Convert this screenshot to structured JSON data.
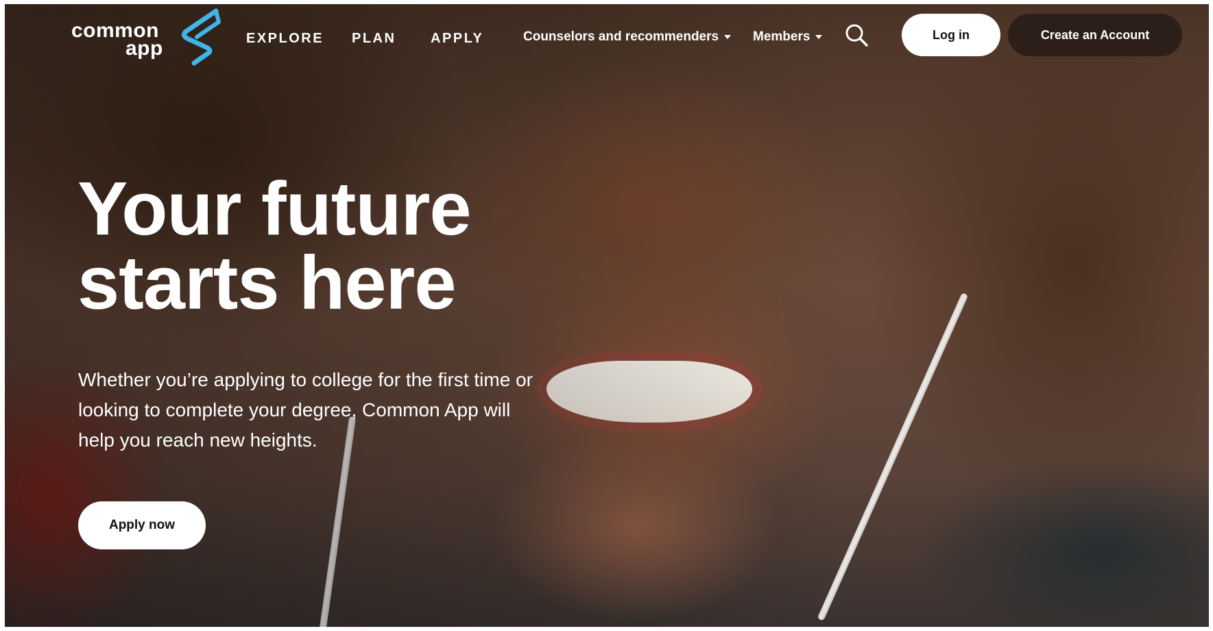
{
  "header": {
    "logo": {
      "line1": "common",
      "line2": "app"
    },
    "nav": [
      {
        "label": "EXPLORE"
      },
      {
        "label": "PLAN"
      },
      {
        "label": "APPLY"
      }
    ],
    "dropdowns": [
      {
        "label": "Counselors and recommenders"
      },
      {
        "label": "Members"
      }
    ],
    "login_label": "Log in",
    "create_account_label": "Create an Account"
  },
  "hero": {
    "title_line1": "Your future",
    "title_line2": "starts here",
    "subtitle_line1": "Whether you’re applying to college for the first time or",
    "subtitle_line2": "looking to complete your degree, Common App will",
    "subtitle_line3": "help you reach new heights.",
    "cta_label": "Apply now"
  },
  "colors": {
    "logo_accent": "#3fb6e8",
    "text": "#ffffff",
    "button_light": "#ffffff",
    "button_dark": "#281c18"
  },
  "icons": {
    "search": "search-icon",
    "caret": "chevron-down-icon",
    "logo_mark": "common-app-logo-mark"
  }
}
